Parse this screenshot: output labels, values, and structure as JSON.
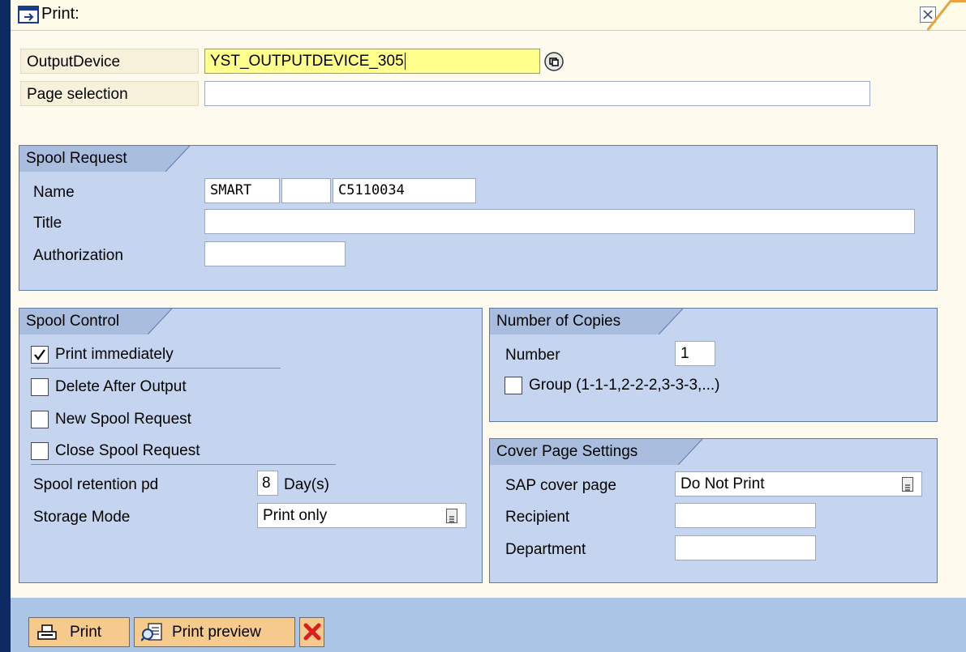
{
  "window": {
    "title": "Print:"
  },
  "header": {
    "output_device_label": "OutputDevice",
    "output_device_value": "YST_OUTPUTDEVICE_305",
    "page_selection_label": "Page selection",
    "page_selection_value": ""
  },
  "spool_request": {
    "title": "Spool Request",
    "name_label": "Name",
    "name_part1": "SMART",
    "name_part2": "",
    "name_part3": "C5110034",
    "title_label": "Title",
    "title_value": "",
    "authorization_label": "Authorization",
    "authorization_value": ""
  },
  "spool_control": {
    "title": "Spool Control",
    "print_immediately": {
      "label": "Print immediately",
      "checked": true
    },
    "delete_after_output": {
      "label": "Delete After Output",
      "checked": false
    },
    "new_spool_request": {
      "label": "New Spool Request",
      "checked": false
    },
    "close_spool_request": {
      "label": "Close Spool Request",
      "checked": false
    },
    "retention_label": "Spool retention pd",
    "retention_value": "8",
    "retention_unit": "Day(s)",
    "storage_mode_label": "Storage Mode",
    "storage_mode_value": "Print only"
  },
  "copies": {
    "title": "Number of Copies",
    "number_label": "Number",
    "number_value": "1",
    "group_label": "Group (1-1-1,2-2-2,3-3-3,...)",
    "group_checked": false
  },
  "cover_page": {
    "title": "Cover Page Settings",
    "sap_cover_label": "SAP cover page",
    "sap_cover_value": "Do Not Print",
    "recipient_label": "Recipient",
    "recipient_value": "",
    "department_label": "Department",
    "department_value": ""
  },
  "footer": {
    "print_label": "Print",
    "print_preview_label": "Print preview"
  },
  "colors": {
    "group_bg": "#c5d5ef",
    "highlight_input": "#ffff8c",
    "button_bg": "#f6c98c",
    "cancel_red": "#d81e1e"
  }
}
